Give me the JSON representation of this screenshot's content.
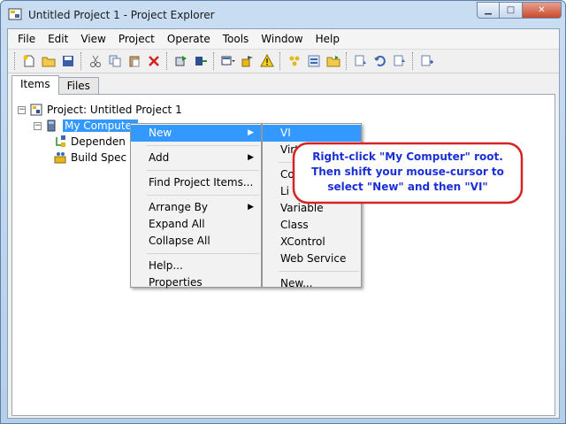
{
  "window": {
    "title": "Untitled Project 1 - Project Explorer"
  },
  "menubar": {
    "items": [
      "File",
      "Edit",
      "View",
      "Project",
      "Operate",
      "Tools",
      "Window",
      "Help"
    ]
  },
  "toolbar": {
    "icons": [
      "new-icon",
      "open-folder-icon",
      "save-all-icon",
      "cut-icon",
      "copy-icon",
      "paste-icon",
      "delete-icon",
      "build-icon",
      "deploy-icon",
      "view-options-icon",
      "project-icon",
      "warning-icon",
      "collapse-icon",
      "expand-icon",
      "folder-icon",
      "cut-down-icon",
      "undo-icon",
      "redo-icon",
      "add-file-icon"
    ]
  },
  "tabs": [
    {
      "label": "Items",
      "active": true
    },
    {
      "label": "Files",
      "active": false
    }
  ],
  "tree": {
    "project": "Project: Untitled Project 1",
    "computer": "My Computer",
    "dependencies": "Dependen",
    "build": "Build Spec"
  },
  "context_menu": {
    "new": "New",
    "add": "Add",
    "find": "Find Project Items...",
    "arrange": "Arrange By",
    "expand": "Expand All",
    "collapse": "Collapse All",
    "help": "Help...",
    "properties": "Properties"
  },
  "submenu": {
    "vi": "VI",
    "virtual": "Virt",
    "control": "Co",
    "library": "Li",
    "variable": "Variable",
    "class": "Class",
    "xcontrol": "XControl",
    "webservice": "Web Service",
    "new": "New..."
  },
  "callout": {
    "line1": "Right-click \"My Computer\" root.",
    "line2": "Then shift your mouse-cursor to",
    "line3": "select \"New\" and then \"VI\""
  }
}
